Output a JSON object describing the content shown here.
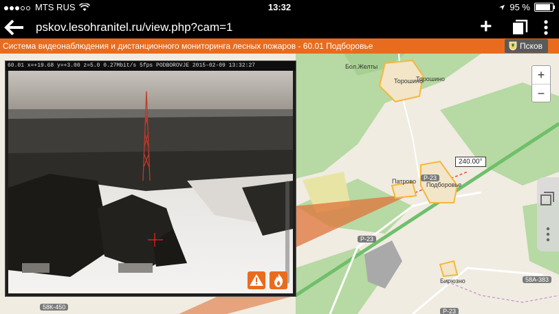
{
  "status": {
    "carrier": "MTS RUS",
    "time": "13:32",
    "battery": "95 %"
  },
  "browser": {
    "url": "pskov.lesohranitel.ru/view.php?cam=1"
  },
  "banner": {
    "title": "Система видеонаблюдения и дистанционного мониторинга лесных пожаров - 60.01 Подборовье",
    "region": "Псков"
  },
  "camera": {
    "overlay": "60.01 x=+19.68 y=+3.00 z=5.0  0.27Mbit/s   5fps PODBOROVJE  2015-02-09 13:32:27"
  },
  "map": {
    "zoom_in": "+",
    "zoom_out": "−",
    "azimuth": "240.00°",
    "labels": {
      "bol_zheltsy": "Бол.Желты",
      "toroshino_a": "Торошино",
      "toroshino_b": "Торошино",
      "patrovo": "Патрово",
      "podborovye": "Подборовье",
      "biryuzno": "Бирюзно"
    },
    "roads": {
      "r23a": "Р-23",
      "r23b": "Р-23",
      "r23c": "Р-23",
      "r58k450": "58К-450",
      "r58a383": "58А-383"
    }
  },
  "colors": {
    "banner": "#e96c1e",
    "sector": "#e0733a",
    "forest": "#b7d9a3",
    "settlement": "#f5b73b"
  }
}
